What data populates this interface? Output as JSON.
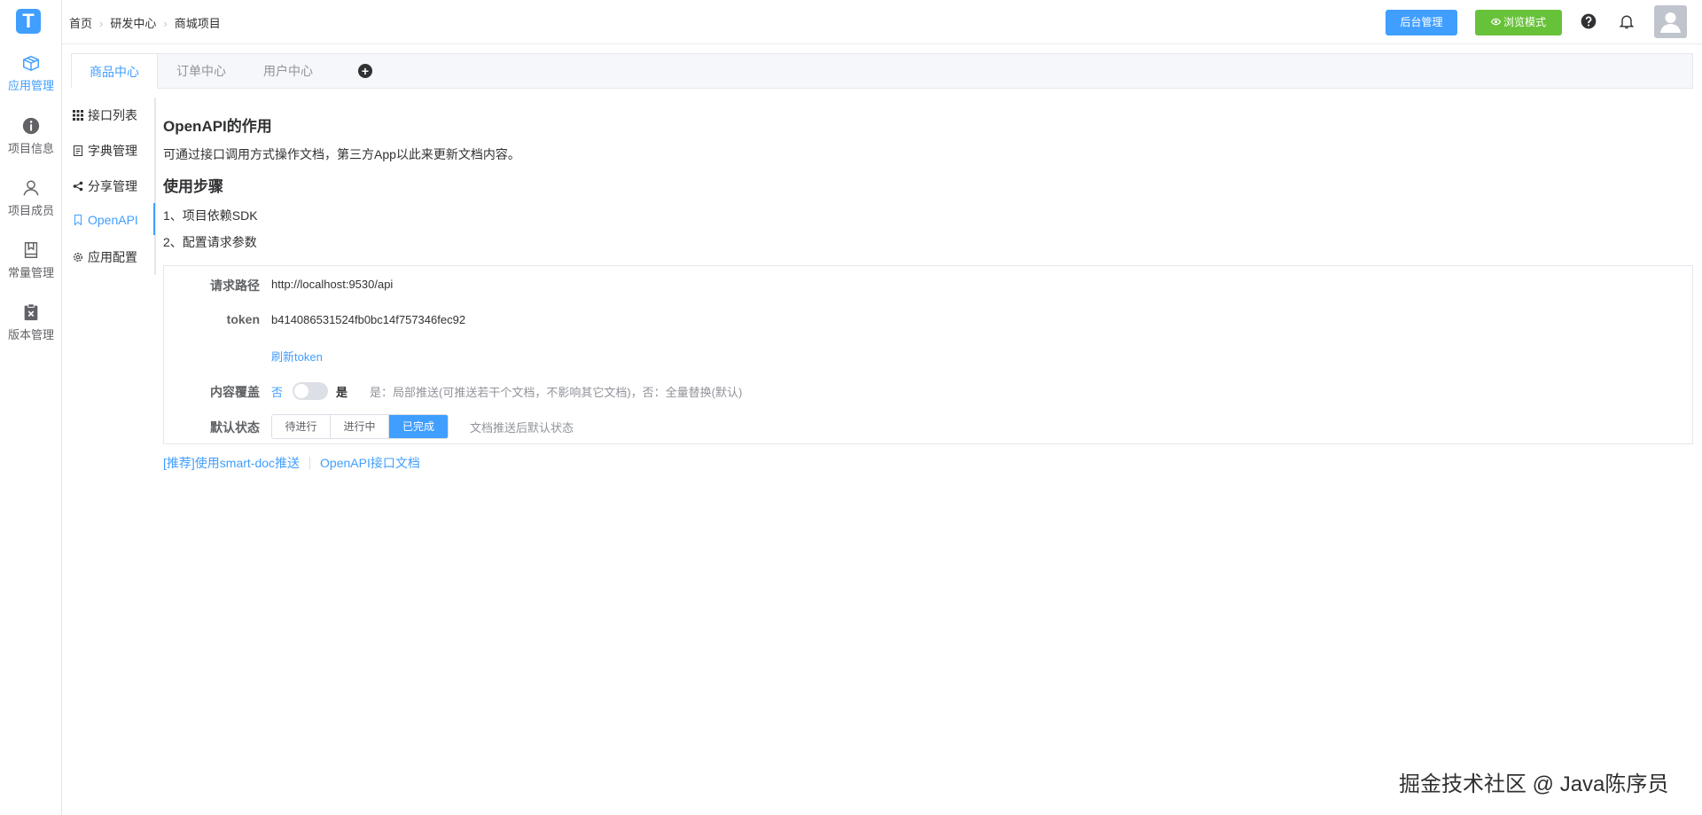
{
  "logo_letter": "T",
  "sidebar": {
    "items": [
      {
        "label": "应用管理",
        "icon": "box-icon",
        "active": true
      },
      {
        "label": "项目信息",
        "icon": "info-icon",
        "active": false
      },
      {
        "label": "项目成员",
        "icon": "user-icon",
        "active": false
      },
      {
        "label": "常量管理",
        "icon": "book-icon",
        "active": false
      },
      {
        "label": "版本管理",
        "icon": "clipboard-icon",
        "active": false
      }
    ]
  },
  "breadcrumb": {
    "items": [
      "首页",
      "研发中心",
      "商城项目"
    ],
    "separator": "›"
  },
  "header": {
    "admin_button": "后台管理",
    "browse_button": "浏览模式"
  },
  "tabs": {
    "items": [
      "商品中心",
      "订单中心",
      "用户中心"
    ],
    "active": "商品中心",
    "add_symbol": "+"
  },
  "submenu": {
    "items": [
      {
        "label": "接口列表",
        "icon": "grid-icon"
      },
      {
        "label": "字典管理",
        "icon": "document-icon"
      },
      {
        "label": "分享管理",
        "icon": "share-icon"
      },
      {
        "label": "OpenAPI",
        "icon": "bookmark-icon"
      },
      {
        "label": "应用配置",
        "icon": "gear-icon"
      }
    ],
    "active": "OpenAPI"
  },
  "main": {
    "title": "OpenAPI的作用",
    "description": "可通过接口调用方式操作文档，第三方App以此来更新文档内容。",
    "steps_title": "使用步骤",
    "step1": "1、项目依赖SDK",
    "step2": "2、配置请求参数"
  },
  "form": {
    "path_label": "请求路径",
    "path_value": "http://localhost:9530/api",
    "token_label": "token",
    "token_value": "b414086531524fb0bc14f757346fec92",
    "refresh_token": "刷新token",
    "overwrite_label": "内容覆盖",
    "switch_off_text": "否",
    "switch_on_text": "是",
    "overwrite_on": false,
    "overwrite_hint": "是：局部推送(可推送若干个文档，不影响其它文档)，否：全量替换(默认)",
    "default_status_label": "默认状态",
    "status_options": [
      "待进行",
      "进行中",
      "已完成"
    ],
    "status_selected": "已完成",
    "status_hint": "文档推送后默认状态"
  },
  "footer_links": {
    "smart_doc": "[推荐]使用smart-doc推送",
    "openapi_doc": "OpenAPI接口文档"
  },
  "watermark": "掘金技术社区 @ Java陈序员",
  "colors": {
    "primary": "#409eff",
    "success": "#67c23a"
  }
}
